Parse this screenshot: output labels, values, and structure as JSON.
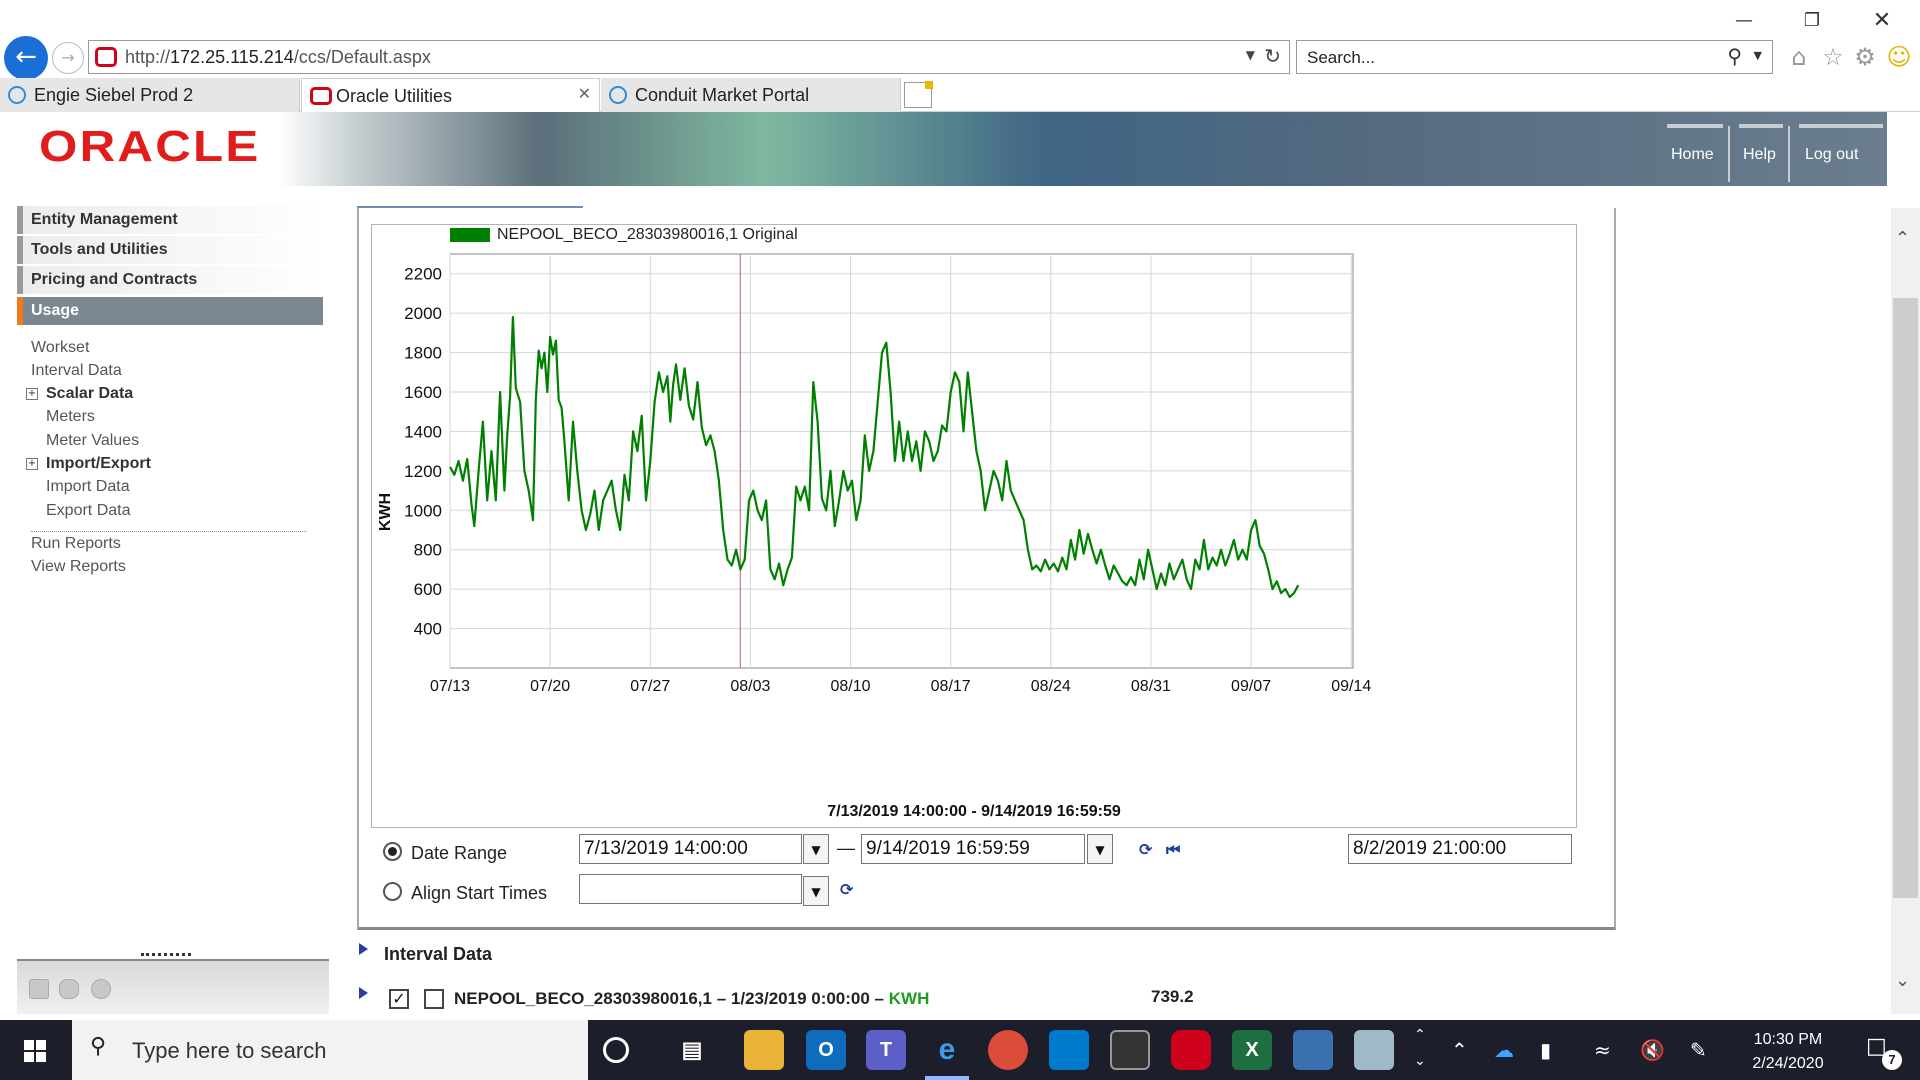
{
  "browser": {
    "url_prefix": "http://",
    "url_host": "172.25.115.214",
    "url_path": "/ccs/Default.aspx",
    "search_placeholder": "Search...",
    "tabs": [
      {
        "label": "Engie Siebel Prod 2",
        "icon": "ie-icon"
      },
      {
        "label": "Oracle Utilities",
        "icon": "oracle-icon",
        "active": true
      },
      {
        "label": "Conduit Market Portal",
        "icon": "ie-icon"
      }
    ]
  },
  "header": {
    "logo": "ORACLE",
    "links": [
      "Home",
      "Help",
      "Log out"
    ]
  },
  "nav": {
    "sections": [
      "Entity Management",
      "Tools and Utilities",
      "Pricing and Contracts",
      "Usage"
    ],
    "items": {
      "workset": "Workset",
      "interval_data": "Interval Data",
      "scalar_data": "Scalar Data",
      "meters": "Meters",
      "meter_values": "Meter Values",
      "import_export": "Import/Export",
      "import_data": "Import Data",
      "export_data": "Export Data",
      "run_reports": "Run Reports",
      "view_reports": "View Reports"
    }
  },
  "chart_data": {
    "type": "line",
    "legend": "NEPOOL_BECO_28303980016,1 Original",
    "series_color": "#008000",
    "ylabel": "KWH",
    "yticks": [
      400,
      600,
      800,
      1000,
      1200,
      1400,
      1600,
      1800,
      2000,
      2200
    ],
    "ylim": [
      200,
      2300
    ],
    "xticks": [
      "07/13",
      "07/20",
      "07/27",
      "08/03",
      "08/10",
      "08/17",
      "08/24",
      "08/31",
      "09/07",
      "09/14"
    ],
    "x_range_days": [
      0,
      63.125
    ],
    "marker_day": 20.29,
    "subtitle": "7/13/2019 14:00:00 - 9/14/2019 16:59:59",
    "points": [
      [
        0.0,
        1220
      ],
      [
        0.3,
        1180
      ],
      [
        0.6,
        1250
      ],
      [
        0.9,
        1150
      ],
      [
        1.2,
        1260
      ],
      [
        1.5,
        1030
      ],
      [
        1.7,
        920
      ],
      [
        2.0,
        1200
      ],
      [
        2.3,
        1450
      ],
      [
        2.6,
        1050
      ],
      [
        2.9,
        1300
      ],
      [
        3.2,
        1050
      ],
      [
        3.5,
        1600
      ],
      [
        3.8,
        1100
      ],
      [
        4.0,
        1380
      ],
      [
        4.2,
        1580
      ],
      [
        4.4,
        1980
      ],
      [
        4.6,
        1620
      ],
      [
        4.9,
        1550
      ],
      [
        5.2,
        1200
      ],
      [
        5.5,
        1100
      ],
      [
        5.8,
        950
      ],
      [
        6.0,
        1560
      ],
      [
        6.2,
        1810
      ],
      [
        6.4,
        1720
      ],
      [
        6.6,
        1800
      ],
      [
        6.8,
        1600
      ],
      [
        7.0,
        1880
      ],
      [
        7.2,
        1790
      ],
      [
        7.4,
        1860
      ],
      [
        7.6,
        1560
      ],
      [
        7.8,
        1520
      ],
      [
        8.0,
        1350
      ],
      [
        8.3,
        1050
      ],
      [
        8.6,
        1450
      ],
      [
        8.9,
        1200
      ],
      [
        9.2,
        1000
      ],
      [
        9.5,
        900
      ],
      [
        9.8,
        980
      ],
      [
        10.1,
        1100
      ],
      [
        10.4,
        900
      ],
      [
        10.7,
        1050
      ],
      [
        11.0,
        1100
      ],
      [
        11.3,
        1150
      ],
      [
        11.6,
        1000
      ],
      [
        11.9,
        900
      ],
      [
        12.2,
        1180
      ],
      [
        12.5,
        1050
      ],
      [
        12.8,
        1400
      ],
      [
        13.1,
        1300
      ],
      [
        13.4,
        1480
      ],
      [
        13.7,
        1050
      ],
      [
        14.0,
        1250
      ],
      [
        14.3,
        1550
      ],
      [
        14.6,
        1700
      ],
      [
        14.9,
        1600
      ],
      [
        15.2,
        1680
      ],
      [
        15.4,
        1450
      ],
      [
        15.6,
        1640
      ],
      [
        15.8,
        1740
      ],
      [
        16.1,
        1560
      ],
      [
        16.4,
        1720
      ],
      [
        16.7,
        1530
      ],
      [
        17.0,
        1460
      ],
      [
        17.3,
        1650
      ],
      [
        17.6,
        1420
      ],
      [
        17.9,
        1330
      ],
      [
        18.2,
        1380
      ],
      [
        18.5,
        1300
      ],
      [
        18.8,
        1150
      ],
      [
        19.1,
        900
      ],
      [
        19.4,
        750
      ],
      [
        19.7,
        720
      ],
      [
        20.0,
        800
      ],
      [
        20.3,
        700
      ],
      [
        20.6,
        750
      ],
      [
        20.9,
        1050
      ],
      [
        21.2,
        1100
      ],
      [
        21.5,
        1000
      ],
      [
        21.8,
        950
      ],
      [
        22.1,
        1050
      ],
      [
        22.4,
        700
      ],
      [
        22.7,
        650
      ],
      [
        23.0,
        730
      ],
      [
        23.3,
        620
      ],
      [
        23.6,
        700
      ],
      [
        23.9,
        760
      ],
      [
        24.2,
        1120
      ],
      [
        24.5,
        1050
      ],
      [
        24.8,
        1120
      ],
      [
        25.1,
        1000
      ],
      [
        25.4,
        1650
      ],
      [
        25.7,
        1450
      ],
      [
        26.0,
        1060
      ],
      [
        26.3,
        1000
      ],
      [
        26.6,
        1200
      ],
      [
        26.9,
        920
      ],
      [
        27.2,
        1050
      ],
      [
        27.5,
        1200
      ],
      [
        27.8,
        1100
      ],
      [
        28.1,
        1150
      ],
      [
        28.4,
        950
      ],
      [
        28.7,
        1050
      ],
      [
        29.0,
        1380
      ],
      [
        29.3,
        1200
      ],
      [
        29.6,
        1300
      ],
      [
        29.9,
        1550
      ],
      [
        30.2,
        1800
      ],
      [
        30.5,
        1850
      ],
      [
        30.8,
        1600
      ],
      [
        31.1,
        1250
      ],
      [
        31.4,
        1450
      ],
      [
        31.7,
        1250
      ],
      [
        32.0,
        1400
      ],
      [
        32.3,
        1250
      ],
      [
        32.6,
        1350
      ],
      [
        32.9,
        1200
      ],
      [
        33.2,
        1400
      ],
      [
        33.5,
        1350
      ],
      [
        33.8,
        1250
      ],
      [
        34.1,
        1300
      ],
      [
        34.4,
        1430
      ],
      [
        34.7,
        1400
      ],
      [
        35.0,
        1600
      ],
      [
        35.3,
        1700
      ],
      [
        35.6,
        1650
      ],
      [
        35.9,
        1400
      ],
      [
        36.2,
        1700
      ],
      [
        36.5,
        1500
      ],
      [
        36.8,
        1300
      ],
      [
        37.1,
        1200
      ],
      [
        37.4,
        1000
      ],
      [
        37.7,
        1100
      ],
      [
        38.0,
        1200
      ],
      [
        38.3,
        1150
      ],
      [
        38.6,
        1050
      ],
      [
        38.9,
        1250
      ],
      [
        39.2,
        1100
      ],
      [
        39.5,
        1050
      ],
      [
        39.8,
        1000
      ],
      [
        40.1,
        950
      ],
      [
        40.4,
        800
      ],
      [
        40.7,
        700
      ],
      [
        41.0,
        720
      ],
      [
        41.3,
        690
      ],
      [
        41.6,
        750
      ],
      [
        41.9,
        700
      ],
      [
        42.2,
        730
      ],
      [
        42.5,
        690
      ],
      [
        42.8,
        760
      ],
      [
        43.1,
        700
      ],
      [
        43.4,
        850
      ],
      [
        43.7,
        750
      ],
      [
        44.0,
        900
      ],
      [
        44.3,
        780
      ],
      [
        44.6,
        880
      ],
      [
        44.9,
        800
      ],
      [
        45.2,
        730
      ],
      [
        45.5,
        800
      ],
      [
        45.8,
        720
      ],
      [
        46.1,
        650
      ],
      [
        46.4,
        720
      ],
      [
        46.7,
        680
      ],
      [
        47.0,
        640
      ],
      [
        47.3,
        620
      ],
      [
        47.6,
        660
      ],
      [
        47.9,
        620
      ],
      [
        48.2,
        750
      ],
      [
        48.5,
        650
      ],
      [
        48.8,
        800
      ],
      [
        49.1,
        700
      ],
      [
        49.4,
        600
      ],
      [
        49.7,
        680
      ],
      [
        50.0,
        620
      ],
      [
        50.3,
        730
      ],
      [
        50.6,
        650
      ],
      [
        50.9,
        700
      ],
      [
        51.2,
        750
      ],
      [
        51.5,
        650
      ],
      [
        51.8,
        600
      ],
      [
        52.1,
        750
      ],
      [
        52.4,
        700
      ],
      [
        52.7,
        850
      ],
      [
        53.0,
        700
      ],
      [
        53.3,
        760
      ],
      [
        53.6,
        720
      ],
      [
        53.9,
        800
      ],
      [
        54.2,
        720
      ],
      [
        54.5,
        780
      ],
      [
        54.8,
        850
      ],
      [
        55.1,
        750
      ],
      [
        55.4,
        800
      ],
      [
        55.7,
        750
      ],
      [
        56.0,
        900
      ],
      [
        56.3,
        950
      ],
      [
        56.6,
        820
      ],
      [
        56.9,
        780
      ],
      [
        57.2,
        700
      ],
      [
        57.5,
        600
      ],
      [
        57.8,
        640
      ],
      [
        58.1,
        580
      ],
      [
        58.4,
        600
      ],
      [
        58.7,
        560
      ],
      [
        59.0,
        580
      ],
      [
        59.3,
        620
      ]
    ]
  },
  "controls": {
    "date_range_label": "Date Range",
    "align_start_label": "Align Start Times",
    "start_value": "7/13/2019 14:00:00",
    "end_value": "9/14/2019 16:59:59",
    "cursor_value": "8/2/2019 21:00:00",
    "align_value": ""
  },
  "interval_section": {
    "title": "Interval Data",
    "row_label": "NEPOOL_BECO_28303980016,1 – 1/23/2019 0:00:00 –",
    "row_unit": "KWH",
    "row_value": "739.2"
  },
  "taskbar": {
    "search_placeholder": "Type here to search",
    "time": "10:30 PM",
    "date": "2/24/2020",
    "notification_count": "7"
  }
}
